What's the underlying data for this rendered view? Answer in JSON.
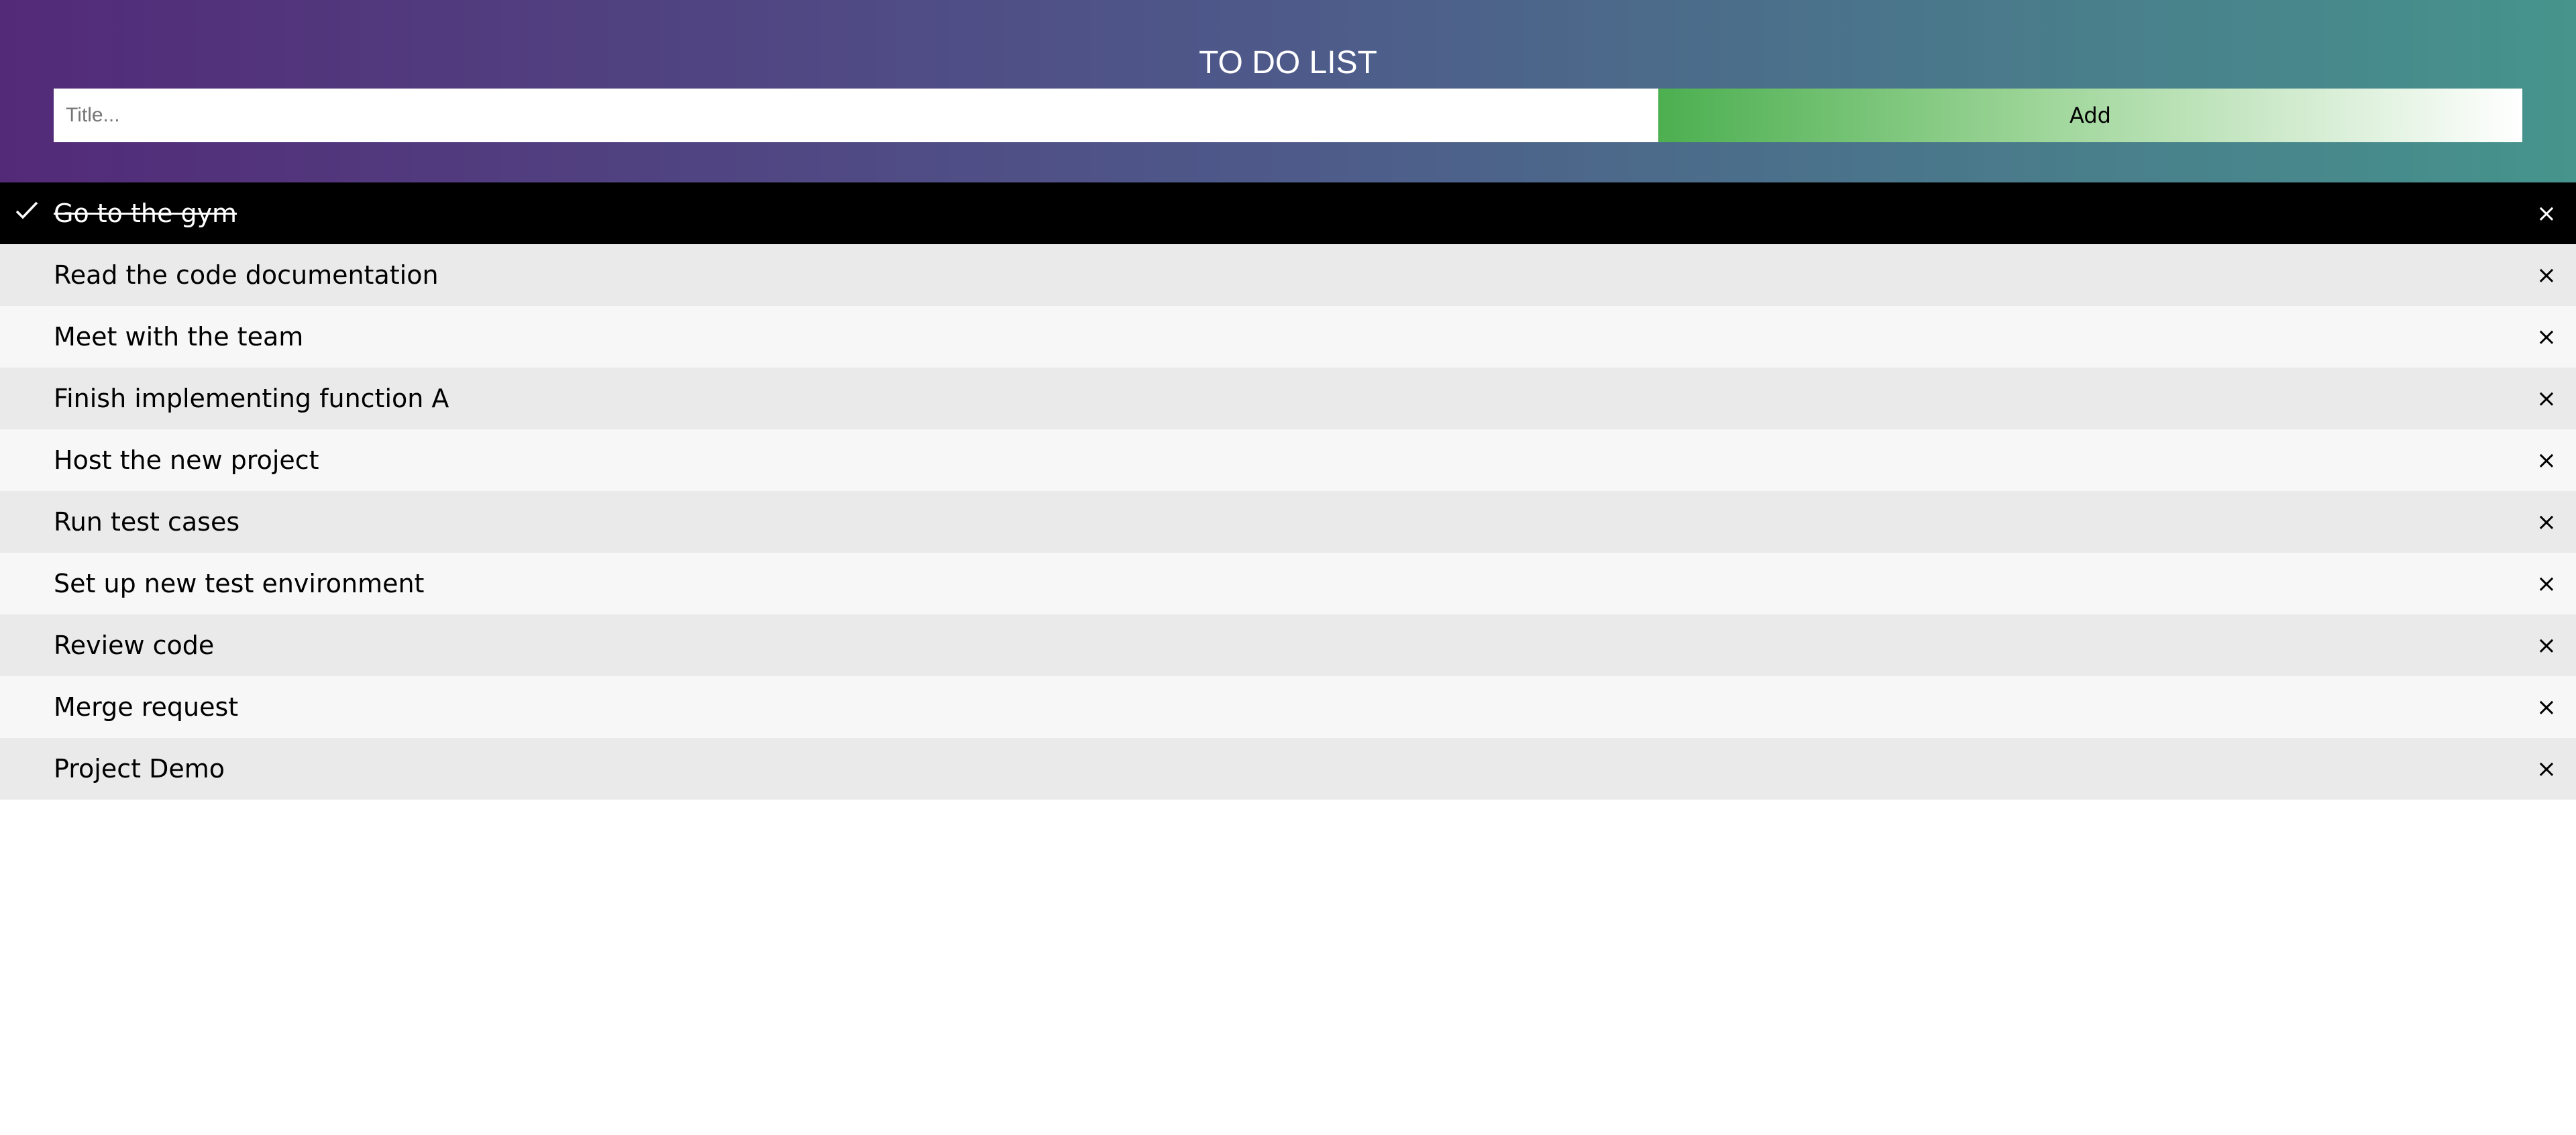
{
  "header": {
    "title": "TO DO LIST",
    "input_placeholder": "Title...",
    "add_label": "Add"
  },
  "todos": [
    {
      "text": "Go to the gym",
      "checked": true
    },
    {
      "text": "Read the code documentation",
      "checked": false
    },
    {
      "text": "Meet with the team",
      "checked": false
    },
    {
      "text": "Finish implementing function A",
      "checked": false
    },
    {
      "text": "Host the new project",
      "checked": false
    },
    {
      "text": "Run test cases",
      "checked": false
    },
    {
      "text": "Set up new test environment",
      "checked": false
    },
    {
      "text": "Review code",
      "checked": false
    },
    {
      "text": "Merge request",
      "checked": false
    },
    {
      "text": "Project Demo",
      "checked": false
    }
  ],
  "icons": {
    "check": "check-icon",
    "close": "close-icon"
  },
  "close_glyph": "×",
  "colors": {
    "header_gradient_start": "#532a78",
    "header_gradient_end": "#46948c",
    "add_button_start": "#4caf50",
    "checked_bg": "#000000",
    "row_odd": "#f7f7f7",
    "row_even": "#eaeaea"
  }
}
